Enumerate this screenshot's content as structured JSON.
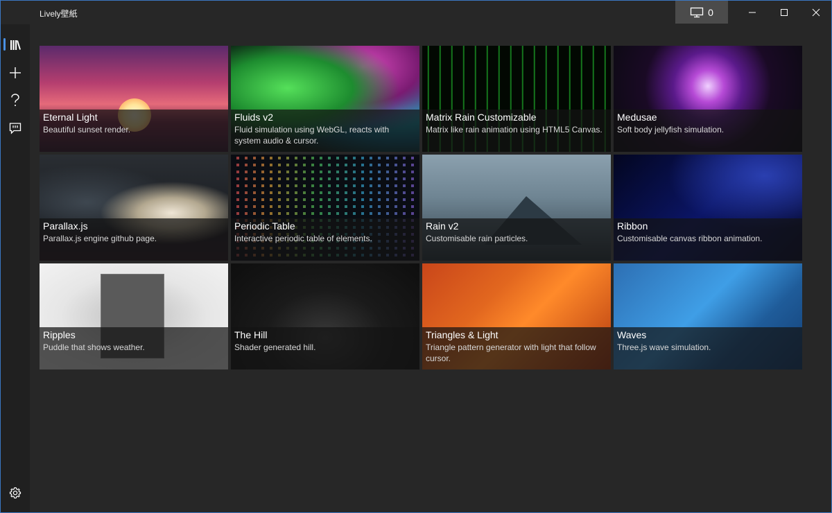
{
  "app": {
    "title": "Lively壁紙"
  },
  "titlebar": {
    "monitor_count": "0",
    "icons": {
      "monitor": "monitor-icon",
      "minimize": "minimize-icon",
      "maximize": "maximize-icon",
      "close": "close-icon"
    }
  },
  "sidebar": {
    "items": [
      {
        "name": "library",
        "icon": "library-icon",
        "active": true
      },
      {
        "name": "add",
        "icon": "add-icon",
        "active": false
      },
      {
        "name": "help",
        "icon": "help-icon",
        "active": false
      },
      {
        "name": "feedback",
        "icon": "feedback-icon",
        "active": false
      }
    ],
    "settings_icon": "gear-icon"
  },
  "library": {
    "tiles": [
      {
        "title": "Eternal Light",
        "desc": "Beautiful sunset render."
      },
      {
        "title": "Fluids v2",
        "desc": "Fluid simulation using WebGL, reacts with system audio & cursor."
      },
      {
        "title": "Matrix Rain Customizable",
        "desc": "Matrix like rain animation using HTML5 Canvas."
      },
      {
        "title": "Medusae",
        "desc": "Soft body jellyfish simulation."
      },
      {
        "title": "Parallax.js",
        "desc": "Parallax.js engine github page."
      },
      {
        "title": "Periodic Table",
        "desc": "Interactive periodic table of elements."
      },
      {
        "title": "Rain v2",
        "desc": "Customisable rain particles."
      },
      {
        "title": "Ribbon",
        "desc": "Customisable canvas ribbon animation."
      },
      {
        "title": "Ripples",
        "desc": "Puddle that shows weather."
      },
      {
        "title": "The Hill",
        "desc": "Shader generated hill."
      },
      {
        "title": "Triangles & Light",
        "desc": "Triangle pattern generator with light that follow cursor."
      },
      {
        "title": "Waves",
        "desc": "Three.js wave simulation."
      }
    ]
  },
  "colors": {
    "accent": "#4a90e2",
    "window_bg": "#272727",
    "sidebar_bg": "#202020",
    "button_bg": "#4b4b4b"
  }
}
